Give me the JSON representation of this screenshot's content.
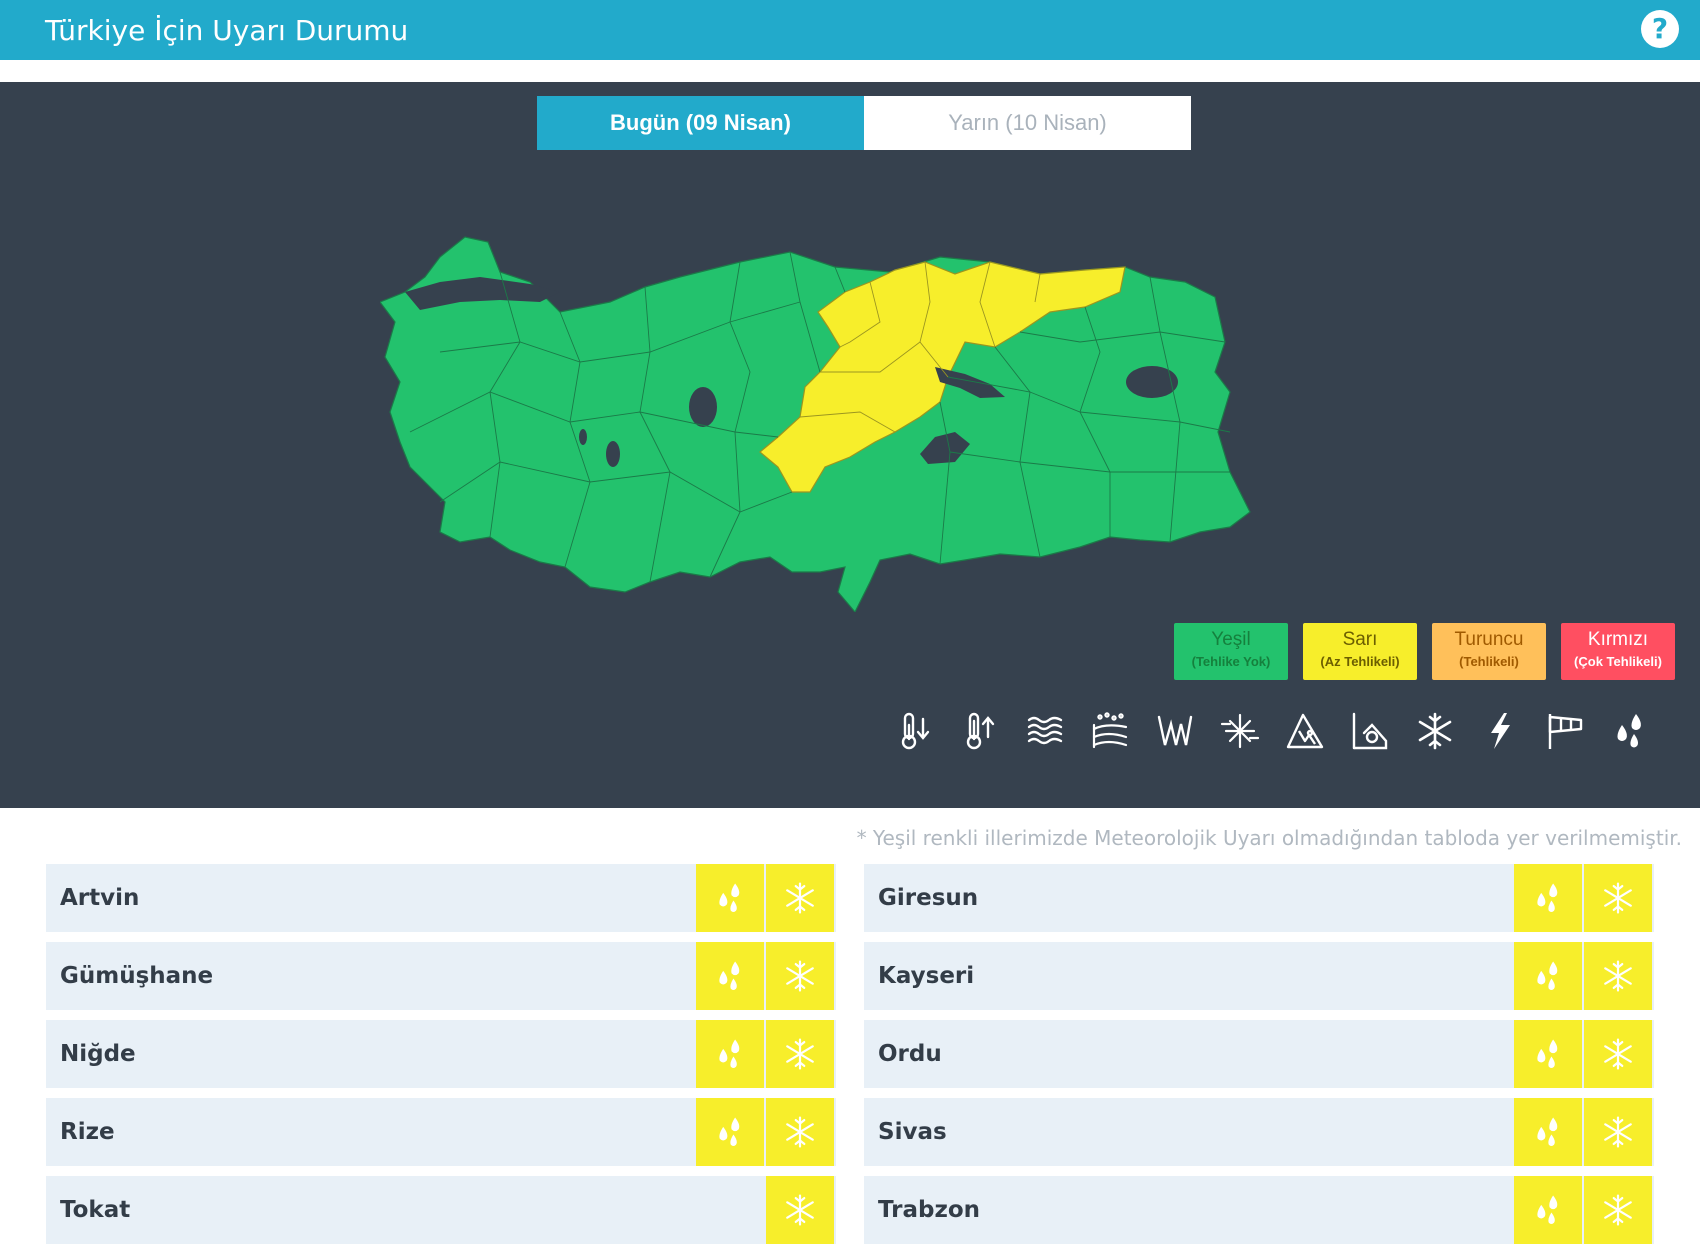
{
  "header": {
    "title": "Türkiye İçin Uyarı Durumu",
    "help_icon": "?"
  },
  "tabs": [
    {
      "label": "Bugün (09 Nisan)",
      "active": true
    },
    {
      "label": "Yarın (10 Nisan)",
      "active": false
    }
  ],
  "legend": [
    {
      "label": "Yeşil",
      "sublabel": "(Tehlike Yok)",
      "color": "#23c26d",
      "text_color": "#15803d"
    },
    {
      "label": "Sarı",
      "sublabel": "(Az Tehlikeli)",
      "color": "#f7ee2b",
      "text_color": "#6b5e00"
    },
    {
      "label": "Turuncu",
      "sublabel": "(Tehlikeli)",
      "color": "#ffc05a",
      "text_color": "#a05a00"
    },
    {
      "label": "Kırmızı",
      "sublabel": "(Çok Tehlikeli)",
      "color": "#ff4f61",
      "text_color": "#ffffff"
    }
  ],
  "hazard_icons": [
    "cold-thermometer-icon",
    "hot-thermometer-icon",
    "fog-icon",
    "dust-icon",
    "frost-icon",
    "avalanche-snow-icon",
    "avalanche-icon",
    "flood-icon",
    "snow-icon",
    "lightning-icon",
    "wind-icon",
    "rain-icon"
  ],
  "note": "* Yeşil renkli illerimizde Meteorolojik Uyarı olmadığından tabloda yer verilmemiştir.",
  "colors": {
    "header": "#22aacb",
    "panel": "#36414e",
    "green": "#23c26d",
    "yellow": "#f7ee2b",
    "row_bg": "#e8f0f7"
  },
  "provinces_left": [
    {
      "name": "Artvin",
      "warnings": [
        "rain",
        "snow"
      ]
    },
    {
      "name": "Gümüşhane",
      "warnings": [
        "rain",
        "snow"
      ]
    },
    {
      "name": "Niğde",
      "warnings": [
        "rain",
        "snow"
      ]
    },
    {
      "name": "Rize",
      "warnings": [
        "rain",
        "snow"
      ]
    },
    {
      "name": "Tokat",
      "warnings": [
        "snow"
      ]
    }
  ],
  "provinces_right": [
    {
      "name": "Giresun",
      "warnings": [
        "rain",
        "snow"
      ]
    },
    {
      "name": "Kayseri",
      "warnings": [
        "rain",
        "snow"
      ]
    },
    {
      "name": "Ordu",
      "warnings": [
        "rain",
        "snow"
      ]
    },
    {
      "name": "Sivas",
      "warnings": [
        "rain",
        "snow"
      ]
    },
    {
      "name": "Trabzon",
      "warnings": [
        "rain",
        "snow"
      ]
    }
  ]
}
